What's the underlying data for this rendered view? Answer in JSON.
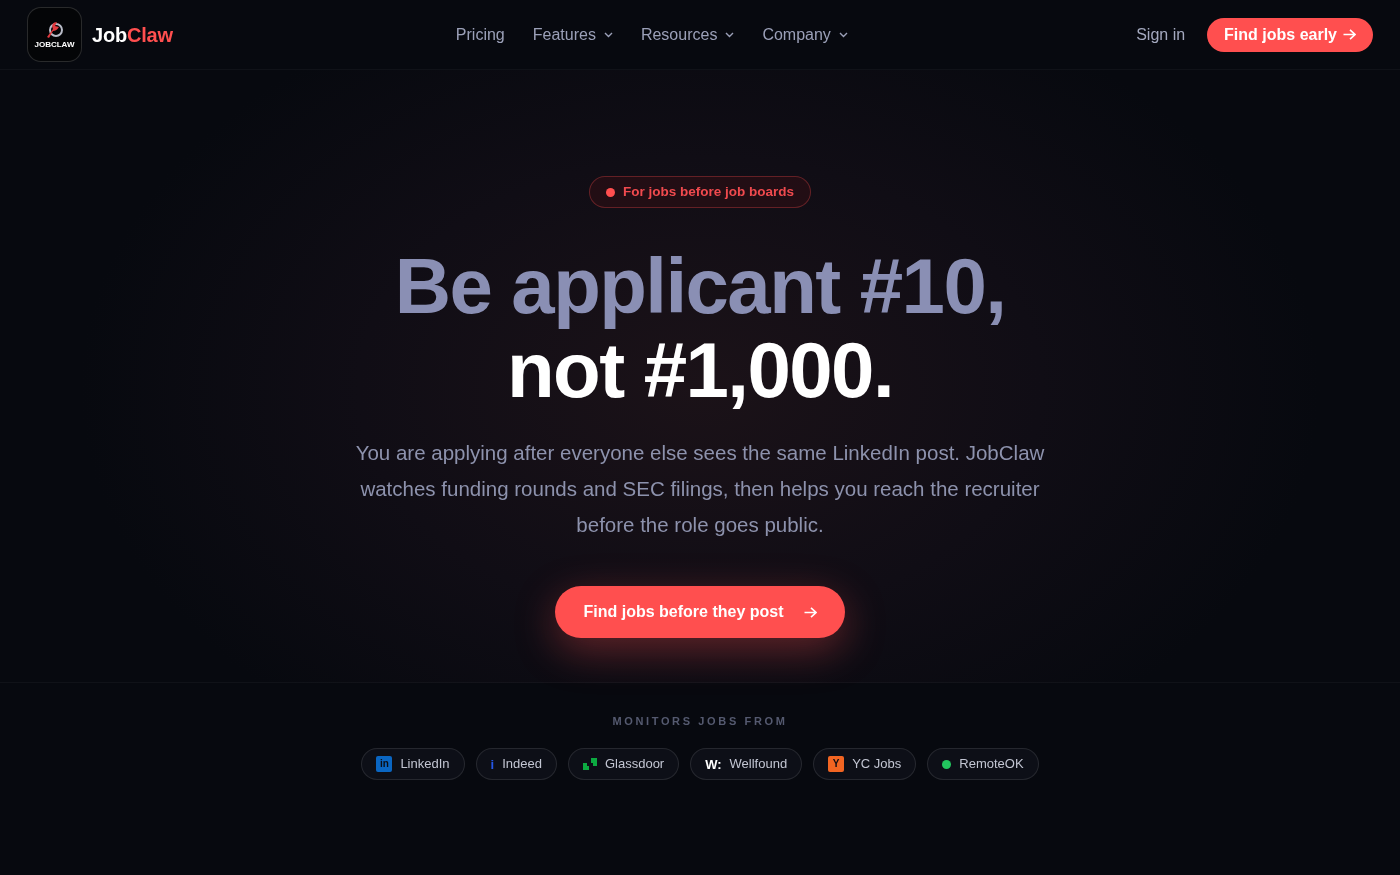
{
  "header": {
    "logo": {
      "caption": "JOBCLAW"
    },
    "brand": [
      {
        "text": "Job",
        "accent": false
      },
      {
        "text": "Claw",
        "accent": true
      }
    ],
    "nav": [
      {
        "label": "Pricing",
        "has_menu": false
      },
      {
        "label": "Features",
        "has_menu": true
      },
      {
        "label": "Resources",
        "has_menu": true
      },
      {
        "label": "Company",
        "has_menu": true
      }
    ],
    "sign_in": "Sign in",
    "cta": "Find jobs early"
  },
  "hero": {
    "badge": "For jobs before job boards",
    "headline": [
      {
        "text": "Be applicant #10,",
        "muted": true
      },
      {
        "text": "not #1,000.",
        "muted": false
      }
    ],
    "lead": "You are applying after everyone else sees the same LinkedIn post. JobClaw watches funding rounds and SEC filings, then helps you reach the recruiter before the role goes public.",
    "cta": "Find jobs before they post"
  },
  "sources": {
    "title": "MONITORS JOBS FROM",
    "items": [
      {
        "name": "LinkedIn",
        "kind": "tile",
        "glyph": "in",
        "color": "#0a66c2"
      },
      {
        "name": "Indeed",
        "kind": "glyph",
        "glyph": "i",
        "color": "#2557e8"
      },
      {
        "name": "Glassdoor",
        "kind": "quotes",
        "color": "#0caa41"
      },
      {
        "name": "Wellfound",
        "kind": "glyph",
        "glyph": "W:",
        "color": "#ffffff"
      },
      {
        "name": "YC Jobs",
        "kind": "tile",
        "glyph": "Y",
        "color": "#f26522"
      },
      {
        "name": "RemoteOK",
        "kind": "dot",
        "color": "#22c55e"
      }
    ]
  }
}
